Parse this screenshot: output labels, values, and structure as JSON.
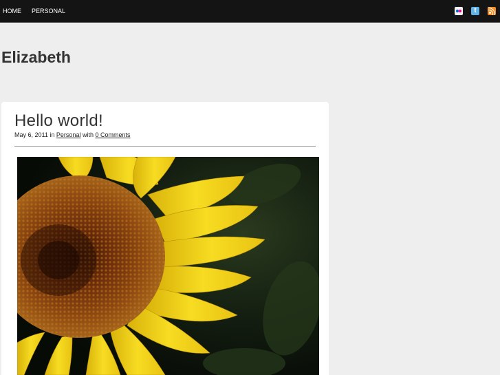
{
  "nav": {
    "items": [
      {
        "label": "HOME"
      },
      {
        "label": "PERSONAL"
      }
    ]
  },
  "social": {
    "icons": [
      "flickr-icon",
      "twitter-icon",
      "rss-icon"
    ],
    "twitter_glyph": "t"
  },
  "site": {
    "title": "Elizabeth"
  },
  "post": {
    "title": "Hello world!",
    "date": "May 6, 2011",
    "in_text": "in",
    "category": "Personal",
    "with_text": "with",
    "comments": "0 Comments"
  },
  "colors": {
    "topbar": "#141414",
    "page_bg": "#eeeeee",
    "petal": "#f2d21a",
    "center": "#6b2e0c"
  }
}
